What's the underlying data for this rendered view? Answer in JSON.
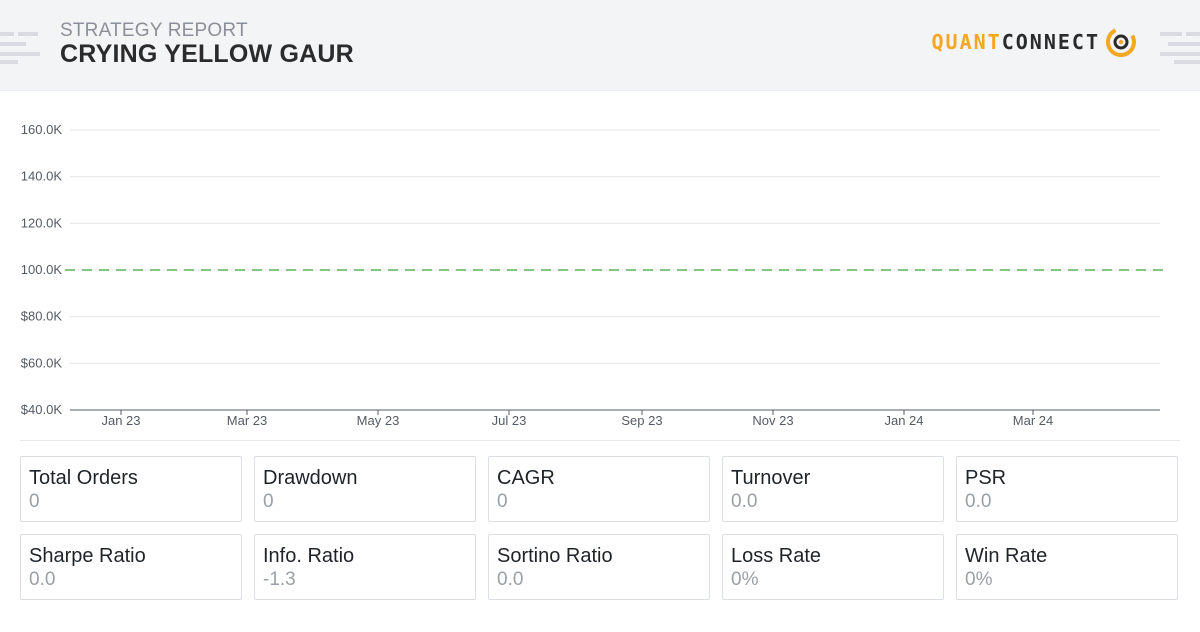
{
  "header": {
    "subtitle": "STRATEGY REPORT",
    "title": "CRYING YELLOW GAUR",
    "logo_quant": "QUANT",
    "logo_connect": "CONNECT",
    "brand_color": "#f5a623"
  },
  "chart_data": {
    "type": "line",
    "title": "",
    "xlabel": "",
    "ylabel": "",
    "x_tick_labels": [
      "Jan 23",
      "Mar 23",
      "May 23",
      "Jul 23",
      "Sep 23",
      "Nov 23",
      "Jan 24",
      "Mar 24"
    ],
    "y_tick_labels": [
      "$40.0K",
      "$60.0K",
      "$80.0K",
      "100.0K",
      "120.0K",
      "140.0K",
      "160.0K"
    ],
    "y_tick_values": [
      40000,
      60000,
      80000,
      100000,
      120000,
      140000,
      160000
    ],
    "ylim": [
      40000,
      160000
    ],
    "grid": true,
    "series": [
      {
        "style": "dashed",
        "color": "#3aa13a",
        "x": [
          "Jan 23",
          "Mar 24"
        ],
        "values": [
          100000,
          100000
        ]
      }
    ]
  },
  "metrics": [
    {
      "label": "Total Orders",
      "value": "0"
    },
    {
      "label": "Drawdown",
      "value": "0"
    },
    {
      "label": "CAGR",
      "value": "0"
    },
    {
      "label": "Turnover",
      "value": "0.0"
    },
    {
      "label": "PSR",
      "value": "0.0"
    },
    {
      "label": "Sharpe Ratio",
      "value": "0.0"
    },
    {
      "label": "Info. Ratio",
      "value": "-1.3"
    },
    {
      "label": "Sortino Ratio",
      "value": "0.0"
    },
    {
      "label": "Loss Rate",
      "value": "0%"
    },
    {
      "label": "Win Rate",
      "value": "0%"
    }
  ]
}
